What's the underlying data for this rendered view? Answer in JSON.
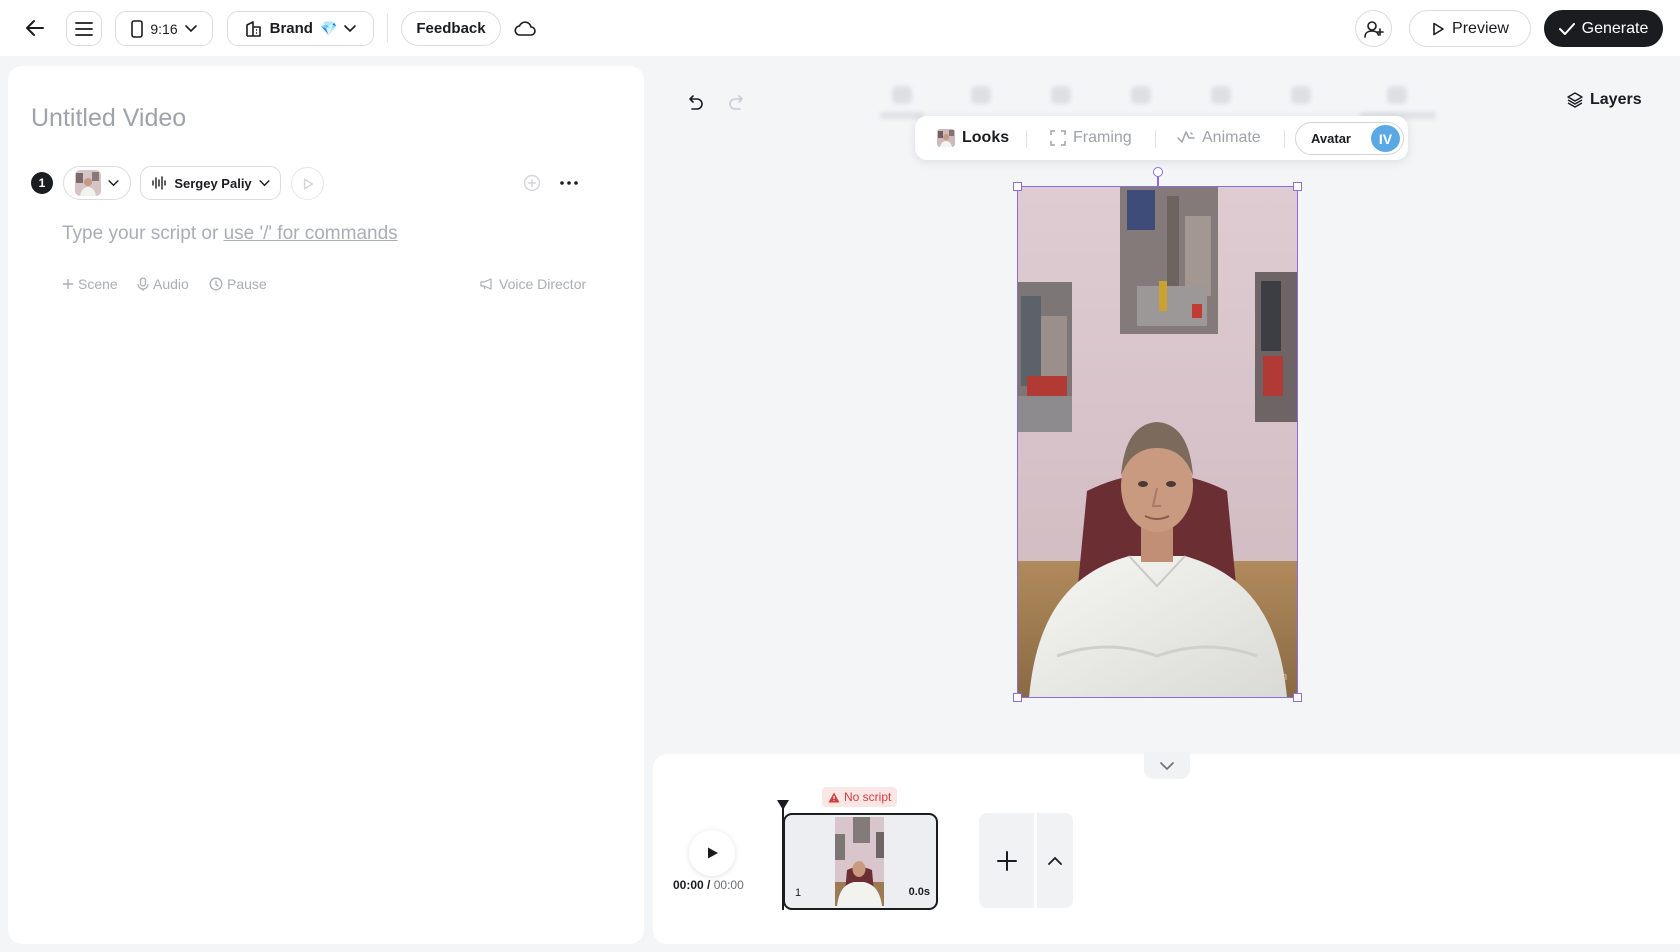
{
  "topbar": {
    "aspect_ratio": "9:16",
    "brand_label": "Brand",
    "brand_badge": "💎",
    "feedback_label": "Feedback",
    "preview_label": "Preview",
    "generate_label": "Generate"
  },
  "script_panel": {
    "title_placeholder": "Untitled Video",
    "scene_number": "1",
    "voice_name": "Sergey Paliy",
    "script_placeholder": "Type your script or ",
    "script_command_hint": "use '/' for commands",
    "actions": {
      "scene": "Scene",
      "audio": "Audio",
      "pause": "Pause",
      "voice_director": "Voice Director"
    }
  },
  "canvas": {
    "layers_label": "Layers",
    "toolbar": {
      "looks": "Looks",
      "framing": "Framing",
      "animate": "Animate",
      "avatar": "Avatar",
      "avatar_initials": "IV"
    },
    "watermark": "HeyGen"
  },
  "timeline": {
    "current_time": "00:00",
    "separator": " / ",
    "total_time": "00:00",
    "warning": "No script",
    "scene_index": "1",
    "scene_duration": "0.0s"
  },
  "colors": {
    "accent_selection": "#8b6dde",
    "generate_bg": "#1b1c1f",
    "warning": "#d13d3d",
    "avatar_chip": "#5aa9e4"
  }
}
